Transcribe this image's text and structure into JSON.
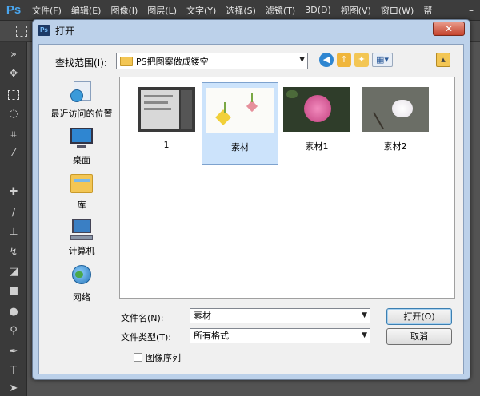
{
  "app": {
    "logo": "Ps",
    "menus": [
      "文件(F)",
      "编辑(E)",
      "图像(I)",
      "图层(L)",
      "文字(Y)",
      "选择(S)",
      "滤镜(T)",
      "3D(D)",
      "视图(V)",
      "窗口(W)",
      "帮"
    ],
    "minimize": "–"
  },
  "dialog": {
    "icon": "Ps",
    "title": "打开",
    "close": "✕",
    "look_in_label": "查找范围(I):",
    "look_in_value": "PS把图案做成镂空",
    "places": [
      {
        "label": "最近访问的位置",
        "icon": "recent-places-icon"
      },
      {
        "label": "桌面",
        "icon": "desktop-icon"
      },
      {
        "label": "库",
        "icon": "libraries-icon"
      },
      {
        "label": "计算机",
        "icon": "computer-icon"
      },
      {
        "label": "网络",
        "icon": "network-icon"
      }
    ],
    "files": [
      {
        "name": "1",
        "selected": false
      },
      {
        "name": "素材",
        "selected": true
      },
      {
        "name": "素材1",
        "selected": false
      },
      {
        "name": "素材2",
        "selected": false
      }
    ],
    "filename_label": "文件名(N):",
    "filename_value": "素材",
    "filetype_label": "文件类型(T):",
    "filetype_value": "所有格式",
    "open_button": "打开(O)",
    "cancel_button": "取消",
    "image_sequence_label": "图像序列",
    "image_sequence_checked": false
  }
}
